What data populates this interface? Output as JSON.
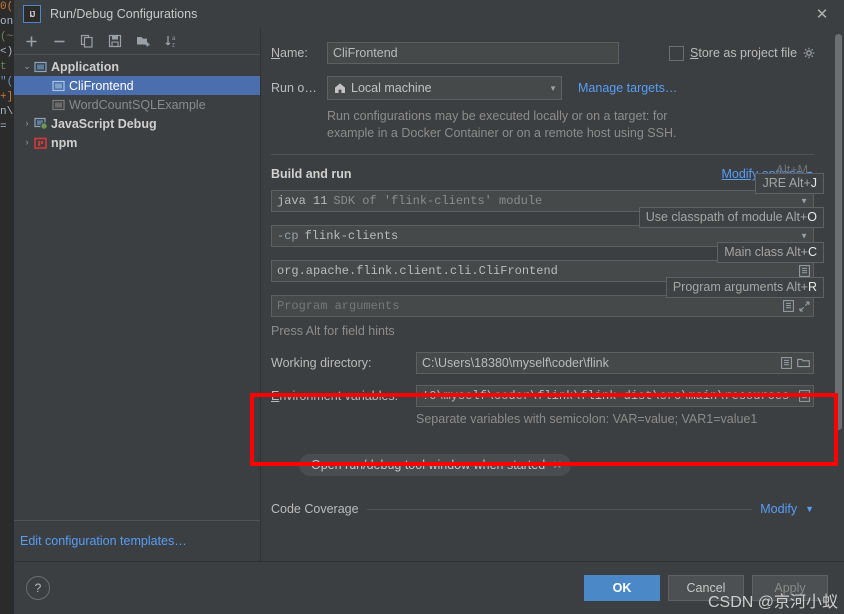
{
  "window": {
    "title": "Run/Debug Configurations",
    "logo_text": "IJ",
    "close_label": "✕"
  },
  "background_editor": {
    "lines": [
      "0(",
      "",
      "on",
      "(~",
      "<)",
      "",
      "",
      "",
      "",
      "",
      "",
      "",
      "",
      "",
      "",
      "t s",
      "\"(",
      "+]",
      "",
      "",
      "n\\",
      "=",
      "",
      "",
      ""
    ]
  },
  "left_panel": {
    "toolbar": [
      {
        "name": "add-configuration-button",
        "glyph": "+",
        "title": "Add New Configuration"
      },
      {
        "name": "remove-configuration-button",
        "glyph": "−",
        "title": "Remove Configuration"
      },
      {
        "name": "copy-configuration-button",
        "glyph": "⧉",
        "title": "Copy Configuration"
      },
      {
        "name": "save-configuration-button",
        "glyph": "὚a",
        "title": "Save Configuration"
      },
      {
        "name": "new-folder-button",
        "glyph": "Ὄ1",
        "title": "Create New Folder"
      },
      {
        "name": "sort-configurations-button",
        "glyph": "↓",
        "title": "Sort Configurations"
      }
    ],
    "tree": [
      {
        "label": "Application",
        "type": "group",
        "expanded": true,
        "arrow": "⌄",
        "icon": "application-icon",
        "indent": 0,
        "selected": false,
        "dim": false
      },
      {
        "label": "CliFrontend",
        "type": "item",
        "expanded": null,
        "arrow": "",
        "icon": "application-config-icon",
        "indent": 1,
        "selected": true,
        "dim": false
      },
      {
        "label": "WordCountSQLExample",
        "type": "item",
        "expanded": null,
        "arrow": "",
        "icon": "application-config-icon",
        "indent": 1,
        "selected": false,
        "dim": true
      },
      {
        "label": "JavaScript Debug",
        "type": "group",
        "expanded": false,
        "arrow": "›",
        "icon": "javascript-debug-icon",
        "indent": 0,
        "selected": false,
        "dim": false
      },
      {
        "label": "npm",
        "type": "group",
        "expanded": false,
        "arrow": "›",
        "icon": "npm-icon",
        "indent": 0,
        "selected": false,
        "dim": false
      }
    ],
    "footer_link": "Edit configuration templates…"
  },
  "main": {
    "name_label": "Name:",
    "name_label_mnemonic": "N",
    "name_value": "CliFrontend",
    "store_as_project_file_label": "Store as project file",
    "store_as_project_file_mnemonic": "S",
    "store_as_project_file_checked": false,
    "gear_icon": "gear-icon",
    "run_on_label": "Run o…",
    "run_on_value": "Local machine",
    "run_on_icon": "home-icon",
    "manage_targets_link": "Manage targets…",
    "run_on_hint_line1": "Run configurations may be executed locally or on a target: for",
    "run_on_hint_line2": "example in a Docker Container or on a remote host using SSH.",
    "build_and_run_title": "Build and run",
    "modify_options_link": "Modify options",
    "modify_options_mnemonic": "M",
    "modify_options_shortcut": "Alt+M",
    "jre_field": {
      "prefix": "java 11",
      "suffix": "SDK of 'flink-clients' module",
      "hint": "JRE",
      "hint_shortcut": "Alt+J",
      "hint_key": "J"
    },
    "classpath_field": {
      "prefix": "-cp",
      "value": "flink-clients",
      "hint": "Use classpath of module",
      "hint_shortcut": "Alt+O",
      "hint_key": "O"
    },
    "main_class_field": {
      "value": "org.apache.flink.client.cli.CliFrontend",
      "hint": "Main class",
      "hint_shortcut": "Alt+C",
      "hint_key": "C"
    },
    "program_arguments_field": {
      "placeholder": "Program arguments",
      "hint": "Program arguments",
      "hint_shortcut": "Alt+R",
      "hint_key": "R"
    },
    "field_hints_note": "Press Alt for field hints",
    "working_directory_label": "Working directory:",
    "working_directory_value": "C:\\Users\\18380\\myself\\coder\\flink",
    "environment_variables_label": "Environment variables:",
    "environment_variables_mnemonic": "E",
    "environment_variables_value": "!0\\myself\\coder\\flink\\flink-dist\\src\\main\\resources",
    "environment_variables_hint": "Separate variables with semicolon: VAR=value; VAR1=value1",
    "chip_label": "Open run/debug tool window when started",
    "chip_close": "✕",
    "code_coverage_label": "Code Coverage",
    "code_coverage_modify_link": "Modify"
  },
  "buttons": {
    "help": "?",
    "ok": "OK",
    "cancel": "Cancel",
    "apply": "Apply"
  },
  "watermark": "CSDN @京河小蚁",
  "colors": {
    "accent_blue": "#4a88c7",
    "link_blue": "#589df6",
    "selection_blue": "#4b6eaf",
    "highlight_red": "#ff0000",
    "panel_bg": "#3c3f41",
    "field_bg": "#45494a",
    "editor_bg": "#2b2b2b"
  }
}
